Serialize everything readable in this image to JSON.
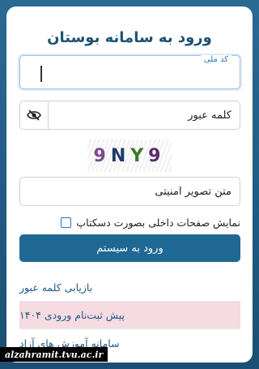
{
  "page_title": "ورود به سامانه بوستان",
  "national_code_field": {
    "label": "کد ملی",
    "value": ""
  },
  "password_field": {
    "placeholder": "کلمه عبور",
    "toggle_icon": "eye-slash-icon"
  },
  "captcha": {
    "chars": [
      "9",
      "N",
      "Y",
      "9"
    ]
  },
  "captcha_field": {
    "placeholder": "متن تصویر امنیتی"
  },
  "desktop_checkbox": {
    "label": "نمایش صفحات داخلی بصورت دسکتاپ",
    "checked": false
  },
  "submit_button": {
    "label": "ورود به سیستم"
  },
  "links": [
    {
      "label": "بازیابی کلمه عبور",
      "highlighted": false
    },
    {
      "label": "پیش ثبت‌نام ورودی ۱۴۰۴",
      "highlighted": true
    },
    {
      "label": "سامانه آموزش های آزاد",
      "highlighted": false
    }
  ],
  "watermark": "alzahramit.tvu.ac.ir",
  "colors": {
    "background": "#2b6a93",
    "primary_button": "#1f6894",
    "title": "#1e5270",
    "highlight": "#f6dbe0"
  }
}
